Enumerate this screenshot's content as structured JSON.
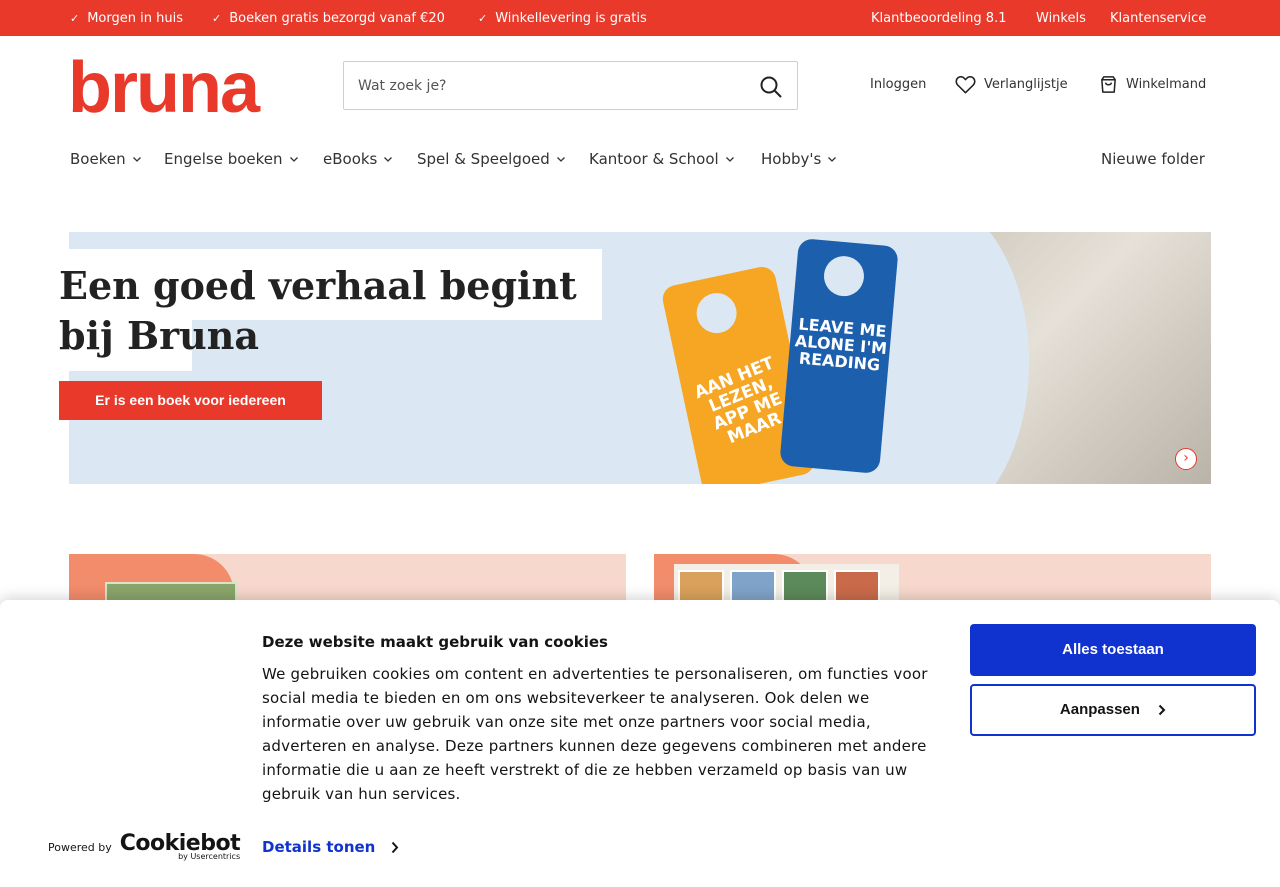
{
  "usp_bar": {
    "items": [
      "Morgen in huis",
      "Boeken gratis bezorgd vanaf €20",
      "Winkellevering is gratis"
    ],
    "rating": "Klantbeoordeling 8.1",
    "stores": "Winkels",
    "service": "Klantenservice",
    "color": "#e8392b"
  },
  "header": {
    "logo_text": "bruna",
    "search_placeholder": "Wat zoek je?",
    "login": "Inloggen",
    "wishlist": "Verlanglijstje",
    "cart": "Winkelmand"
  },
  "nav": {
    "items": [
      "Boeken",
      "Engelse boeken",
      "eBooks",
      "Spel & Speelgoed",
      "Kantoor & School",
      "Hobby's"
    ],
    "folder": "Nieuwe folder"
  },
  "hero": {
    "title": "Een goed verhaal begint bij Bruna",
    "cta": "Er is een boek voor iedereen",
    "hanger_orange": "AAN HET LEZEN, APP ME MAAR",
    "hanger_blue": "LEAVE ME ALONE I'M READING"
  },
  "cookie": {
    "title": "Deze website maakt gebruik van cookies",
    "body": "We gebruiken cookies om content en advertenties te personaliseren, om functies voor social media te bieden en om ons websiteverkeer te analyseren. Ook delen we informatie over uw gebruik van onze site met onze partners voor social media, adverteren en analyse. Deze partners kunnen deze gegevens combineren met andere informatie die u aan ze heeft verstrekt of die ze hebben verzameld op basis van uw gebruik van hun services.",
    "details": "Details tonen",
    "allow": "Alles toestaan",
    "customize": "Aanpassen",
    "powered_by": "Powered by",
    "brand": "Cookiebot",
    "brand_sub": "by Usercentrics",
    "accent": "#1032cf"
  }
}
